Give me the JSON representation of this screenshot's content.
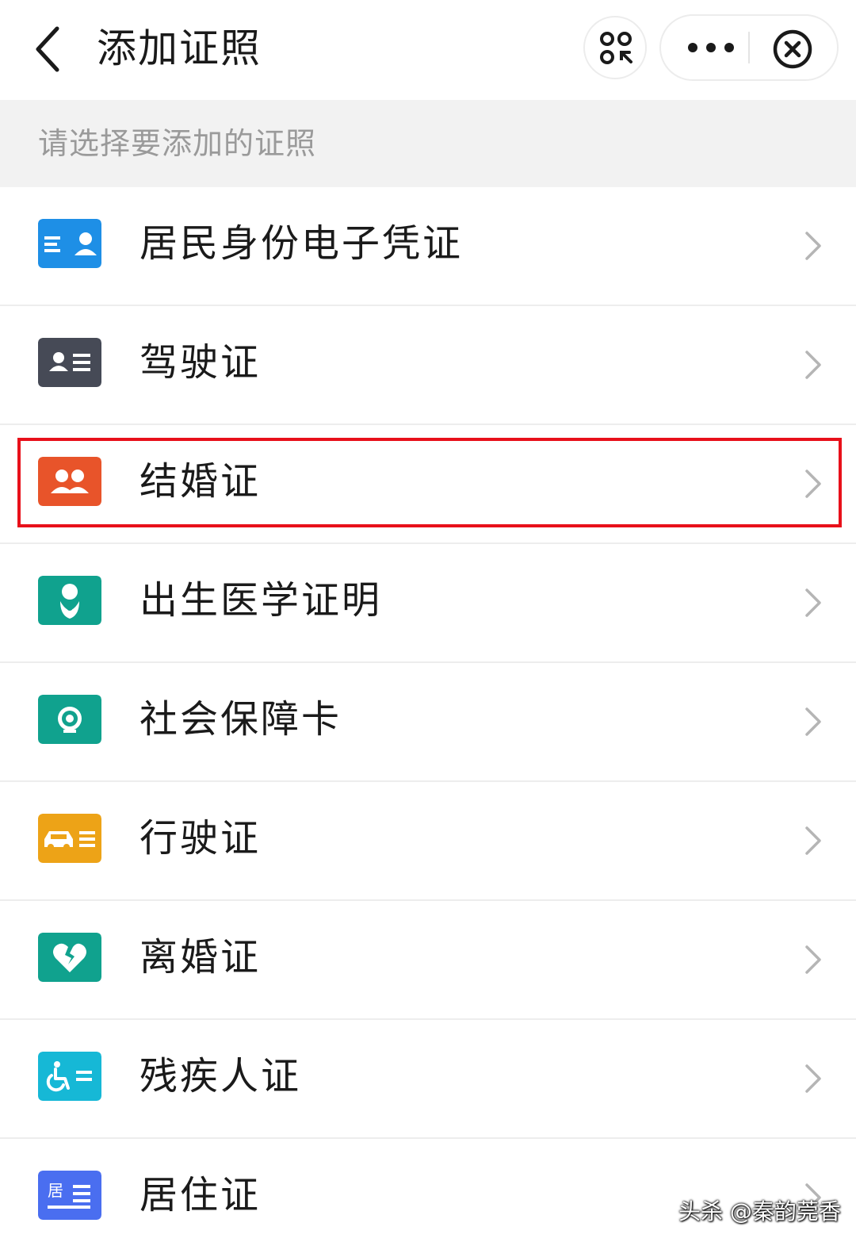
{
  "header": {
    "title": "添加证照",
    "back_icon": "chevron-left-icon",
    "scan_icon": "mini-program-switch-icon",
    "more_icon": "more-dots-icon",
    "close_icon": "close-circle-icon"
  },
  "subheader": {
    "text": "请选择要添加的证照"
  },
  "items": [
    {
      "label": "居民身份电子凭证",
      "icon": "id-card-icon",
      "color": "#1e8fe6"
    },
    {
      "label": "驾驶证",
      "icon": "driver-license-icon",
      "color": "#464a56"
    },
    {
      "label": "结婚证",
      "icon": "couple-icon",
      "color": "#e8542a"
    },
    {
      "label": "出生医学证明",
      "icon": "baby-icon",
      "color": "#10a28e"
    },
    {
      "label": "社会保障卡",
      "icon": "social-security-icon",
      "color": "#10a28e"
    },
    {
      "label": "行驶证",
      "icon": "car-icon",
      "color": "#eda317"
    },
    {
      "label": "离婚证",
      "icon": "broken-heart-icon",
      "color": "#10a28e"
    },
    {
      "label": "残疾人证",
      "icon": "wheelchair-icon",
      "color": "#16b8d6"
    },
    {
      "label": "居住证",
      "icon": "residence-permit-icon",
      "color": "#4a6ef0",
      "icon_text": "居"
    }
  ],
  "highlight_color": "#e8101a",
  "watermark": "头杀 @秦韵莞香"
}
